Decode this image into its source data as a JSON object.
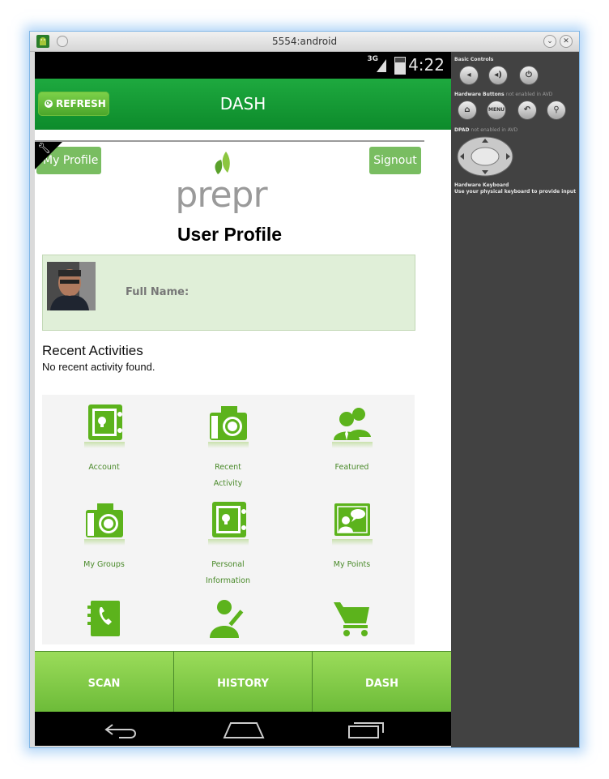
{
  "window": {
    "title": "5554:android"
  },
  "status_bar": {
    "network": "3G",
    "time": "4:22"
  },
  "action_bar": {
    "refresh_label": "REFRESH",
    "title": "DASH"
  },
  "header": {
    "my_profile_label": "My Profile",
    "signout_label": "Signout",
    "logo_text": "prepr"
  },
  "profile": {
    "heading": "User Profile",
    "full_name_label": "Full Name:"
  },
  "recent": {
    "heading": "Recent Activities",
    "empty_text": "No recent activity found."
  },
  "tiles": [
    {
      "label_1": "Account",
      "label_2": "",
      "icon": "safe-icon"
    },
    {
      "label_1": "Recent",
      "label_2": "Activity",
      "icon": "camera-icon"
    },
    {
      "label_1": "Featured",
      "label_2": "",
      "icon": "users-icon"
    },
    {
      "label_1": "My Groups",
      "label_2": "",
      "icon": "camera-icon"
    },
    {
      "label_1": "Personal",
      "label_2": "Information",
      "icon": "safe-icon"
    },
    {
      "label_1": "My Points",
      "label_2": "",
      "icon": "presentation-icon"
    },
    {
      "label_1": "",
      "label_2": "",
      "icon": "contacts-book-icon"
    },
    {
      "label_1": "",
      "label_2": "",
      "icon": "user-edit-icon"
    },
    {
      "label_1": "",
      "label_2": "",
      "icon": "shopping-cart-icon"
    }
  ],
  "bottom_tabs": [
    {
      "label": "SCAN"
    },
    {
      "label": "HISTORY"
    },
    {
      "label": "DASH"
    }
  ],
  "emulator_controls": {
    "basic_title": "Basic Controls",
    "hardware_title": "Hardware Buttons",
    "hardware_sub": "not enabled in AVD",
    "menu_label": "MENU",
    "dpad_title": "DPAD",
    "dpad_sub": "not enabled in AVD",
    "keyboard_title": "Hardware Keyboard",
    "keyboard_sub": "Use your physical keyboard to provide input"
  },
  "colors": {
    "green_dark": "#0d8b2b",
    "green_button": "#79bd61",
    "tile_green": "#5cb31c",
    "profile_bg": "#e0efd8"
  }
}
